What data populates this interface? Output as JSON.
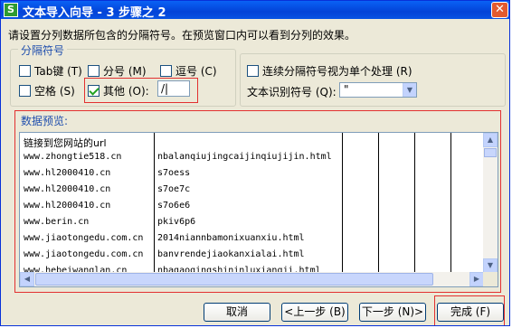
{
  "window": {
    "app_icon": "S",
    "title": "文本导入向导 - 3 步骤之 2",
    "close_glyph": "✕"
  },
  "intro_text": "请设置分列数据所包含的分隔符号。在预览窗口内可以看到分列的效果。",
  "delimiters": {
    "legend": "分隔符号",
    "tab": {
      "label": "Tab键 (T)",
      "checked": false
    },
    "semicolon": {
      "label": "分号 (M)",
      "checked": false
    },
    "comma": {
      "label": "逗号 (C)",
      "checked": false
    },
    "space": {
      "label": "空格 (S)",
      "checked": false
    },
    "other": {
      "label": "其他 (O):",
      "checked": true,
      "value": "/|"
    }
  },
  "options": {
    "consecutive": {
      "label": "连续分隔符号视为单个处理 (R)",
      "checked": false
    },
    "qualifier_label": "文本识别符号 (Q):",
    "qualifier_value": "\""
  },
  "preview": {
    "label": "数据预览:",
    "rows": [
      [
        "链接到您网站的url",
        ""
      ],
      [
        "www.zhongtie518.cn",
        "nbalanqiujingcaijinqiujijin.html"
      ],
      [
        "www.hl2000410.cn",
        "s7oess"
      ],
      [
        "www.hl2000410.cn",
        "s7oe7c"
      ],
      [
        "www.hl2000410.cn",
        "s7o6e6"
      ],
      [
        "www.berin.cn",
        "pkiv6p6"
      ],
      [
        "www.jiaotongedu.com.cn",
        "2014niannbamonixuanxiu.html"
      ],
      [
        "www.jiaotongedu.com.cn",
        "banvrendejiaokanxialai.html"
      ],
      [
        "www.hebeiwanglan.cn",
        "nbagaogingshininluxiangji.html"
      ]
    ]
  },
  "buttons": {
    "cancel": "取消",
    "prev": "<上一步 (B)",
    "next": "下一步 (N)>",
    "finish": "完成 (F)"
  },
  "icons": {
    "scroll_up": "▲",
    "scroll_down": "▼",
    "scroll_left": "◀",
    "scroll_right": "▶",
    "combo_arrow": "▼"
  }
}
